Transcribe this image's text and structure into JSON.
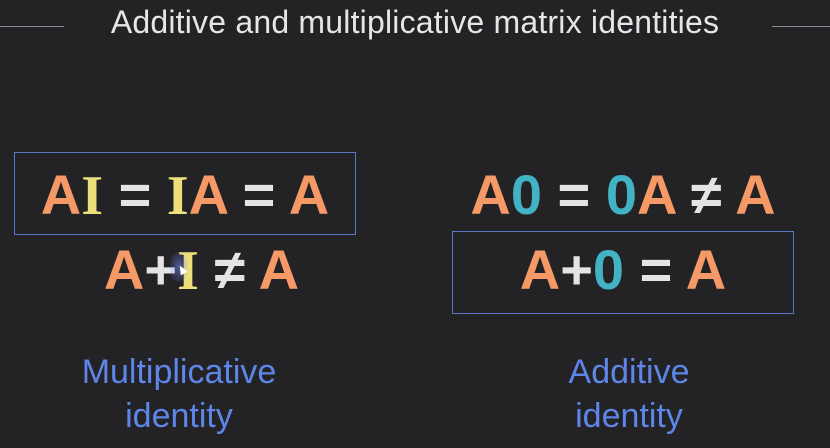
{
  "title": "Additive and multiplicative matrix identities",
  "left": {
    "eq1": {
      "a1": "A",
      "i1": "I",
      "op1": " = ",
      "i2": "I",
      "a2": "A",
      "op2": " = ",
      "a3": "A"
    },
    "eq2": {
      "a1": "A",
      "op1": "+",
      "i1": "I",
      "op2": " ≠ ",
      "a2": "A"
    },
    "caption_line1": "Multiplicative",
    "caption_line2": "identity"
  },
  "right": {
    "eq1": {
      "a1": "A",
      "z1": "0",
      "op1": " = ",
      "z2": "0",
      "a2": "A",
      "op2": " ≠ ",
      "a3": "A"
    },
    "eq2": {
      "a1": "A",
      "op1": "+",
      "z1": "0",
      "op2": " = ",
      "a2": "A"
    },
    "caption_line1": "Additive",
    "caption_line2": "identity"
  },
  "colors": {
    "matrix_A": "#f59a67",
    "identity_I": "#ede07a",
    "zero_matrix": "#42b3c4",
    "caption": "#5e86e8",
    "box_border": "#5a78c7"
  }
}
